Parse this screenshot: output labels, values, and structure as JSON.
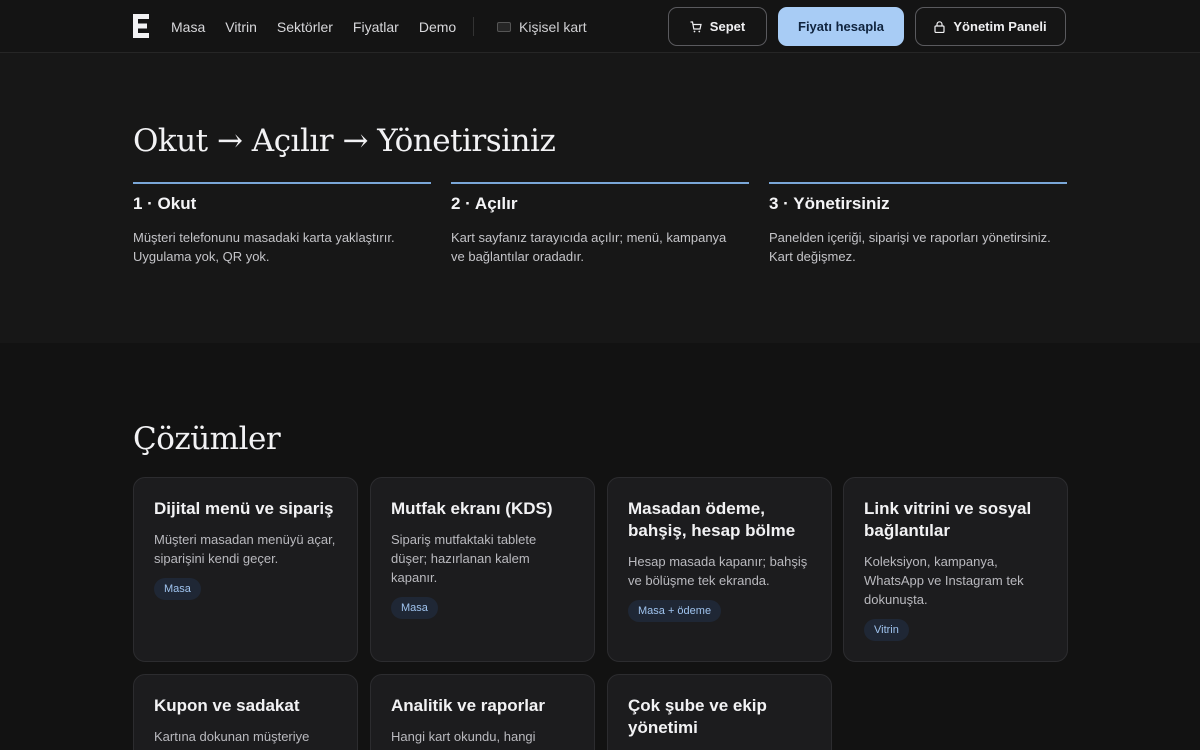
{
  "nav": {
    "links": [
      "Masa",
      "Vitrin",
      "Sektörler",
      "Fiyatlar",
      "Demo"
    ],
    "personal_card": "Kişisel kart",
    "cart_label": "Sepet",
    "price_label": "Fiyatı hesapla",
    "admin_label": "Yönetim Paneli"
  },
  "steps": {
    "heading": "Okut → Açılır → Yönetirsiniz",
    "items": [
      {
        "title": "1 · Okut",
        "desc": "Müşteri telefonunu masadaki karta yaklaştırır. Uygulama yok, QR yok."
      },
      {
        "title": "2 · Açılır",
        "desc": "Kart sayfanız tarayıcıda açılır; menü, kampanya ve bağlantılar oradadır."
      },
      {
        "title": "3 · Yönetirsiniz",
        "desc": "Panelden içeriği, siparişi ve raporları yönetirsiniz. Kart değişmez."
      }
    ]
  },
  "solutions": {
    "heading": "Çözümler",
    "cards": [
      {
        "title": "Dijital menü ve sipariş",
        "desc": "Müşteri masadan menüyü açar, siparişini kendi geçer.",
        "badge": "Masa"
      },
      {
        "title": "Mutfak ekranı (KDS)",
        "desc": "Sipariş mutfaktaki tablete düşer; hazırlanan kalem kapanır.",
        "badge": "Masa"
      },
      {
        "title": "Masadan ödeme, bahşiş, hesap bölme",
        "desc": "Hesap masada kapanır; bahşiş ve bölüşme tek ekranda.",
        "badge": "Masa + ödeme"
      },
      {
        "title": "Link vitrini ve sosyal bağlantılar",
        "desc": "Koleksiyon, kampanya, WhatsApp ve Instagram tek dokunuşta.",
        "badge": "Vitrin"
      },
      {
        "title": "Kupon ve sadakat",
        "desc": "Kartına dokunan müşteriye",
        "badge": ""
      },
      {
        "title": "Analitik ve raporlar",
        "desc": "Hangi kart okundu, hangi",
        "badge": ""
      },
      {
        "title": "Çok şube ve ekip yönetimi",
        "desc": "",
        "badge": ""
      }
    ]
  }
}
